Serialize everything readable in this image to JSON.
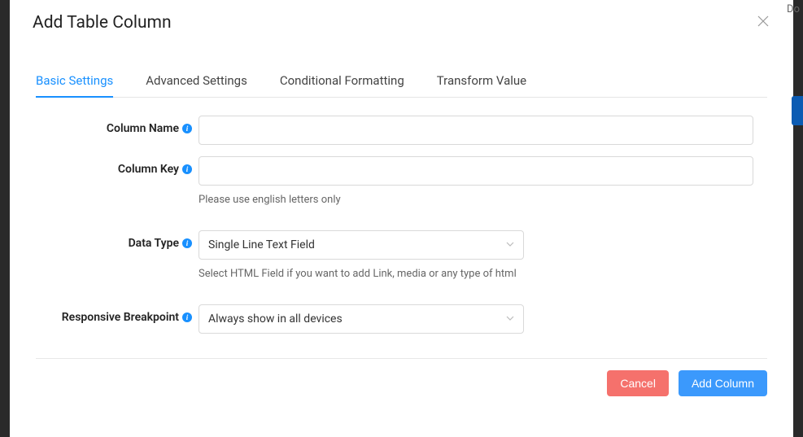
{
  "bg": {
    "corner_text": "Do"
  },
  "modal": {
    "title": "Add Table Column",
    "tabs": [
      {
        "label": "Basic Settings",
        "active": true
      },
      {
        "label": "Advanced Settings",
        "active": false
      },
      {
        "label": "Conditional Formatting",
        "active": false
      },
      {
        "label": "Transform Value",
        "active": false
      }
    ],
    "fields": {
      "column_name": {
        "label": "Column Name",
        "value": ""
      },
      "column_key": {
        "label": "Column Key",
        "value": "",
        "help": "Please use english letters only"
      },
      "data_type": {
        "label": "Data Type",
        "value": "Single Line Text Field",
        "help": "Select HTML Field if you want to add Link, media or any type of html"
      },
      "responsive_breakpoint": {
        "label": "Responsive Breakpoint",
        "value": "Always show in all devices"
      }
    },
    "buttons": {
      "cancel": "Cancel",
      "submit": "Add Column"
    }
  }
}
